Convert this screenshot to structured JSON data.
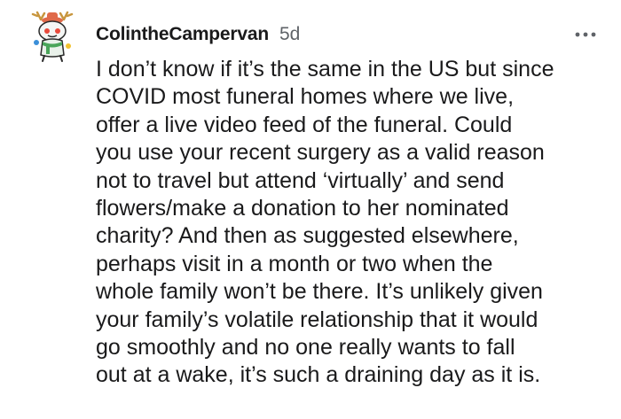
{
  "comment": {
    "username": "ColintheCampervan",
    "age": "5d",
    "avatar_icon": "snoo-avatar-icon",
    "more_icon": "more-options-icon",
    "body_lines": [
      "I don’t know if it’s the same in the US but since",
      "COVID most funeral homes where we live,",
      "offer a live video feed of the funeral. Could",
      "you use your recent surgery as a valid reason",
      "not to travel but attend ‘virtually’ and send",
      "flowers/make a donation to her nominated",
      "charity? And then as suggested elsewhere,",
      "perhaps visit in a month or two when the",
      "whole family won’t be there. It’s unlikely given",
      "your family’s volatile relationship that it would",
      "go smoothly and no one really wants to fall",
      "out at a wake, it’s such a draining day as it is."
    ]
  }
}
